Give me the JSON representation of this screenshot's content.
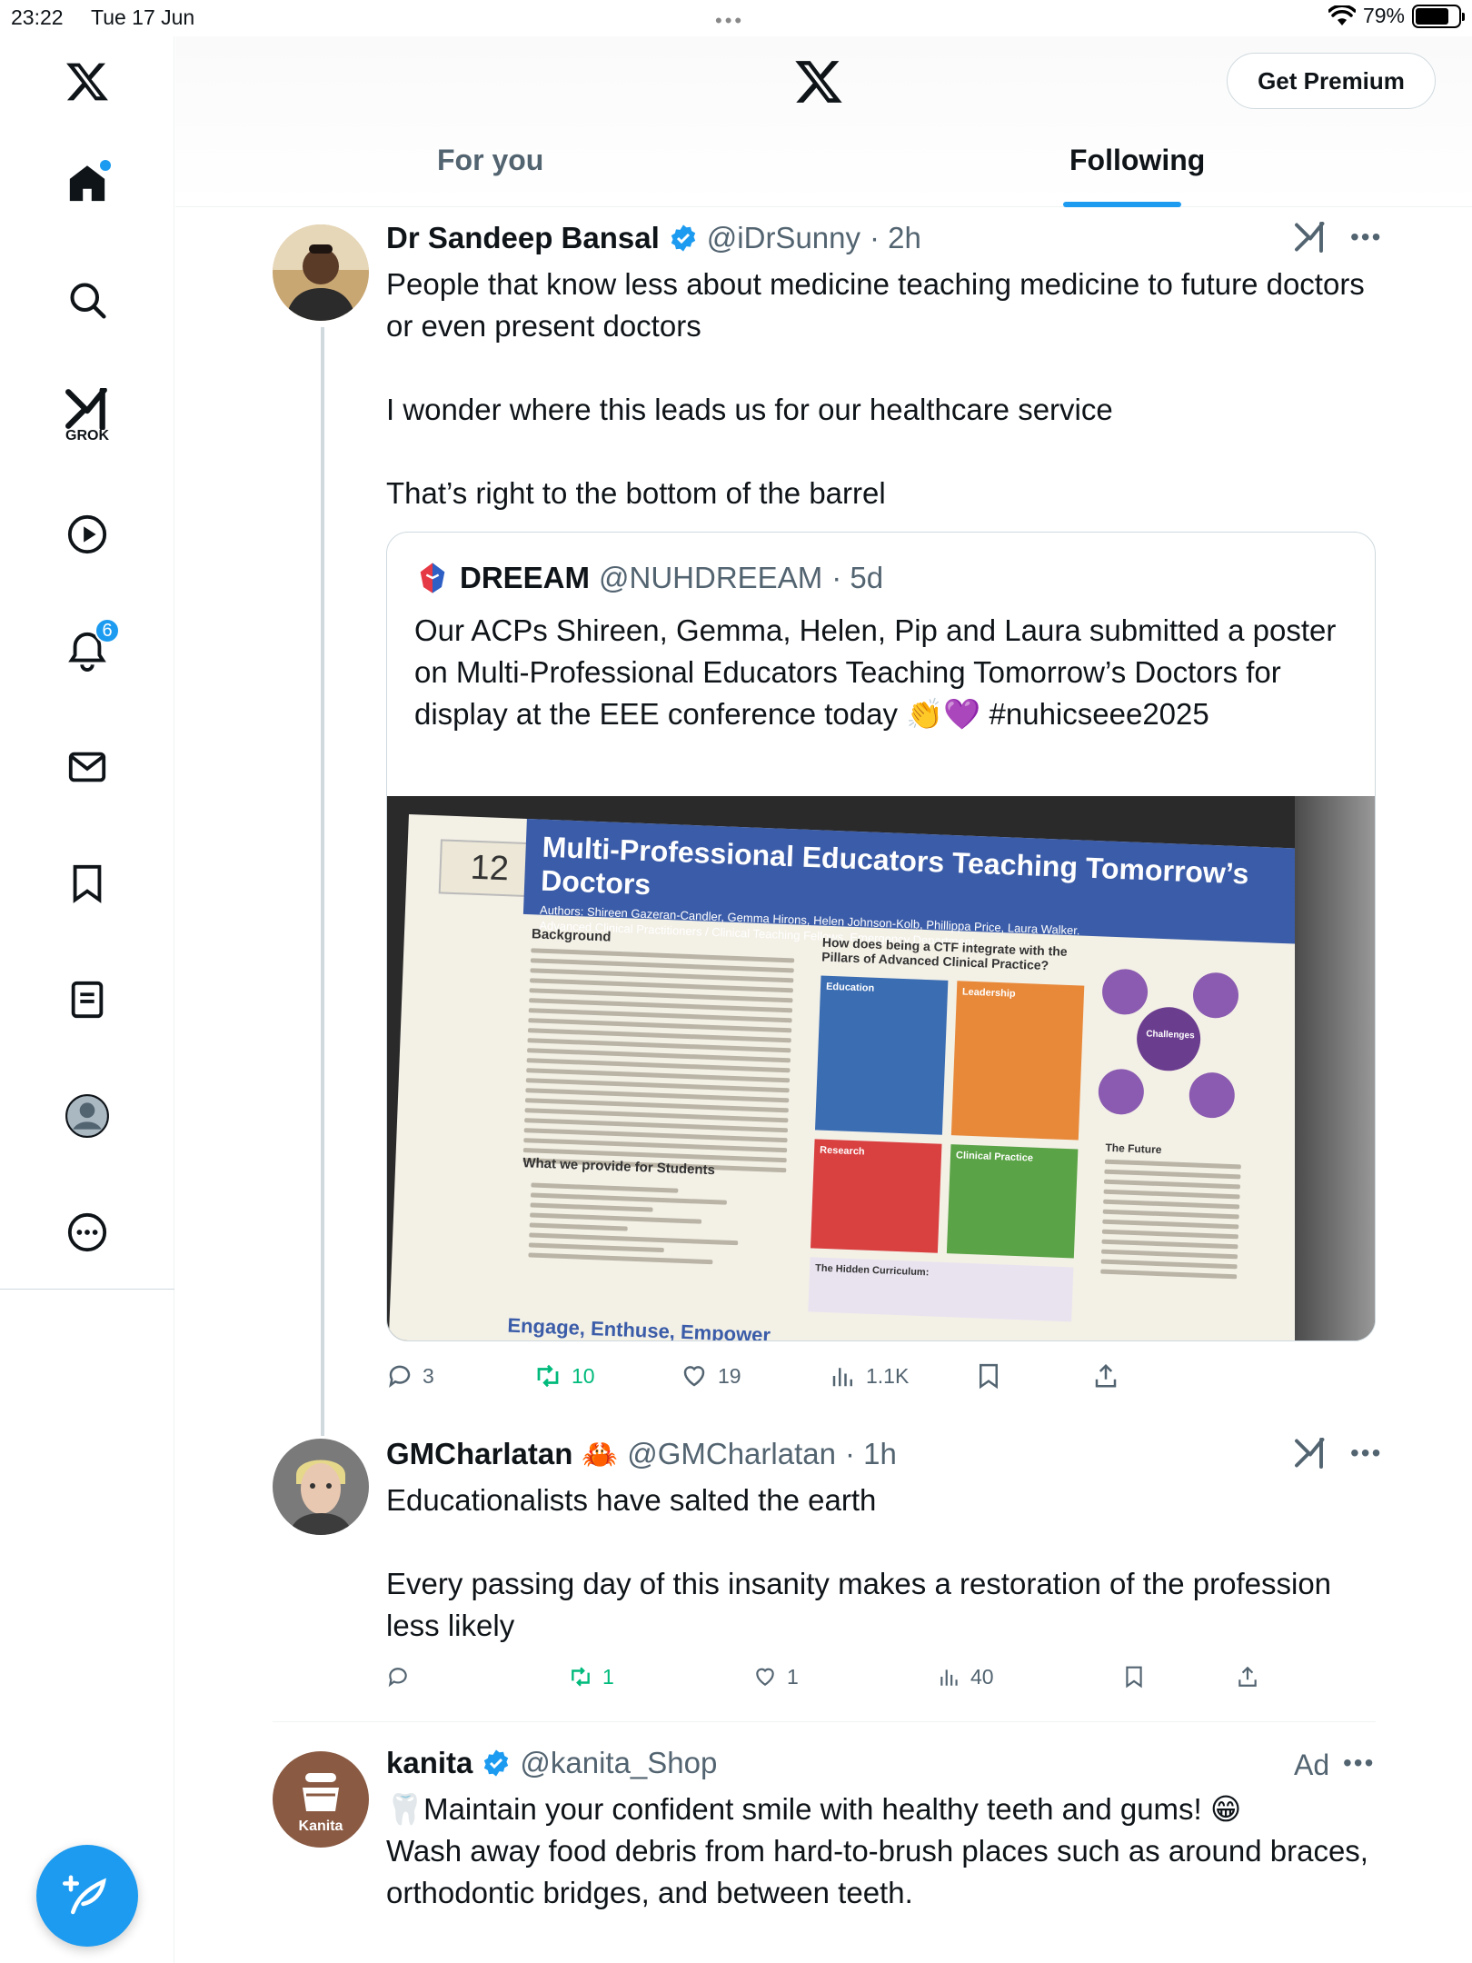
{
  "status_bar": {
    "time": "23:22",
    "date": "Tue 17 Jun",
    "battery": "79%",
    "battery_level": 0.79
  },
  "sidebar": {
    "grok_label": "GROK",
    "notifications_count": "6"
  },
  "header": {
    "premium_label": "Get Premium",
    "tabs": [
      {
        "label": "For you",
        "active": false
      },
      {
        "label": "Following",
        "active": true
      }
    ]
  },
  "tweets": [
    {
      "name": "Dr Sandeep Bansal",
      "handle": "@iDrSunny",
      "time": "· 2h",
      "verified": true,
      "text": "People that know less about medicine teaching medicine to future doctors or even present doctors\n\nI wonder where this leads us for our healthcare service\n\nThat’s right to the bottom of the barrel",
      "quote": {
        "name": "DREEAM",
        "handle": "@NUHDREEAM",
        "time": "· 5d",
        "text": "Our ACPs Shireen, Gemma, Helen, Pip and Laura submitted a poster on Multi-Professional Educators Teaching Tomorrow’s Doctors for display at the EEE conference today 👏💜 #nuhicseee2025",
        "image": {
          "number": "12",
          "title": "Multi-Professional Educators Teaching Tomorrow’s Doctors",
          "authors": "Authors: Shireen Gazeran-Candler, Gemma Hirons, Helen Johnson-Kolb, Phillippa Price, Laura Walker.",
          "subtitle": "Advanced Clinical Practitioners / Clinical Teaching Fellows, Emergency Department.",
          "background_heading": "Background",
          "question": "How does being a CTF integrate with the Pillars of Advanced Clinical Practice?",
          "education": "Education",
          "leadership": "Leadership",
          "research": "Research",
          "clinical": "Clinical Practice",
          "challenges": "Challenges",
          "students_heading": "What we provide for Students",
          "hidden": "The Hidden Curriculum:",
          "future": "The Future",
          "footer": "Engage, Enthuse, Empower"
        }
      },
      "stats": {
        "replies": "3",
        "reposts": "10",
        "likes": "19",
        "views": "1.1K"
      }
    },
    {
      "name": "GMCharlatan",
      "emoji": "🦀",
      "handle": "@GMCharlatan",
      "time": "· 1h",
      "text": "Educationalists have salted the earth\n\nEvery passing day of this insanity makes a restoration of the profession less likely",
      "stats": {
        "replies": "",
        "reposts": "1",
        "likes": "1",
        "views": "40"
      }
    },
    {
      "name": "kanita",
      "handle": "@kanita_Shop",
      "verified": true,
      "ad_label": "Ad",
      "avatar_label": "Kanita",
      "text": "🦷Maintain your confident smile with healthy teeth and gums! 😁\nWash away food debris from hard-to-brush places such as around braces, orthodontic bridges, and between teeth."
    }
  ],
  "colors": {
    "accent": "#1d9bf0",
    "repost": "#00ba7c",
    "muted": "#536471",
    "heart": "#8b5cf6"
  }
}
